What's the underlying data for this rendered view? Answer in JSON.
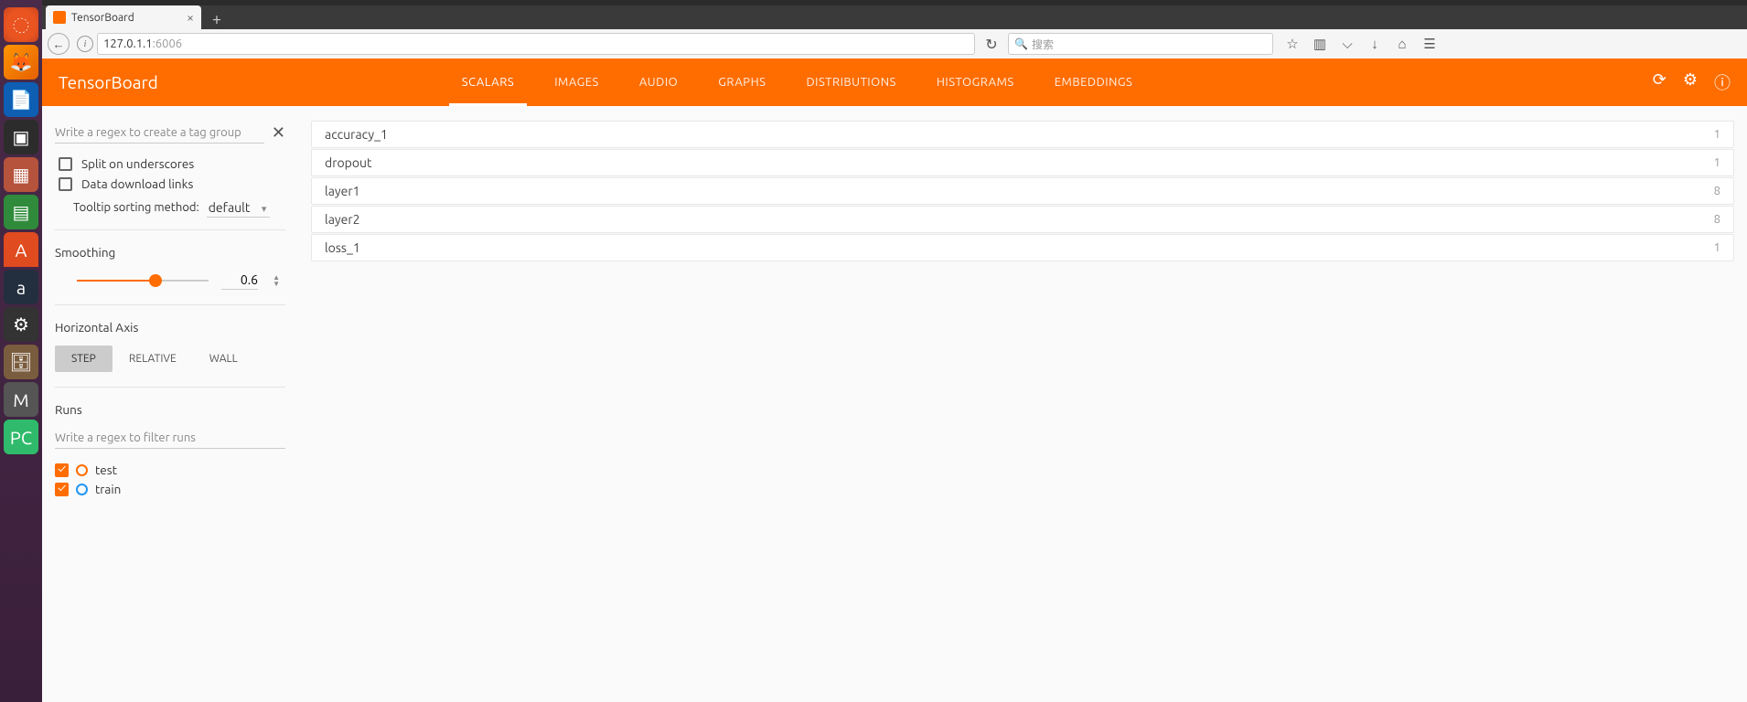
{
  "browser": {
    "tab_title": "TensorBoard",
    "url_host": "127.0.1.1",
    "url_port": ":6006",
    "search_placeholder": "搜索"
  },
  "header": {
    "title": "TensorBoard",
    "tabs": {
      "scalars": "SCALARS",
      "images": "IMAGES",
      "audio": "AUDIO",
      "graphs": "GRAPHS",
      "distributions": "DISTRIBUTIONS",
      "histograms": "HISTOGRAMS",
      "embeddings": "EMBEDDINGS"
    }
  },
  "sidebar": {
    "tag_regex_placeholder": "Write a regex to create a tag group",
    "split_underscores": "Split on underscores",
    "data_download": "Data download links",
    "tooltip_label": "Tooltip sorting method:",
    "tooltip_value": "default",
    "smoothing_label": "Smoothing",
    "smoothing_value": "0.6",
    "haxis_label": "Horizontal Axis",
    "axis_step": "STEP",
    "axis_relative": "RELATIVE",
    "axis_wall": "WALL",
    "runs_label": "Runs",
    "runs_regex_placeholder": "Write a regex to filter runs",
    "run_test": "test",
    "run_train": "train"
  },
  "panels": [
    {
      "name": "accuracy_1",
      "count": "1"
    },
    {
      "name": "dropout",
      "count": "1"
    },
    {
      "name": "layer1",
      "count": "8"
    },
    {
      "name": "layer2",
      "count": "8"
    },
    {
      "name": "loss_1",
      "count": "1"
    }
  ]
}
